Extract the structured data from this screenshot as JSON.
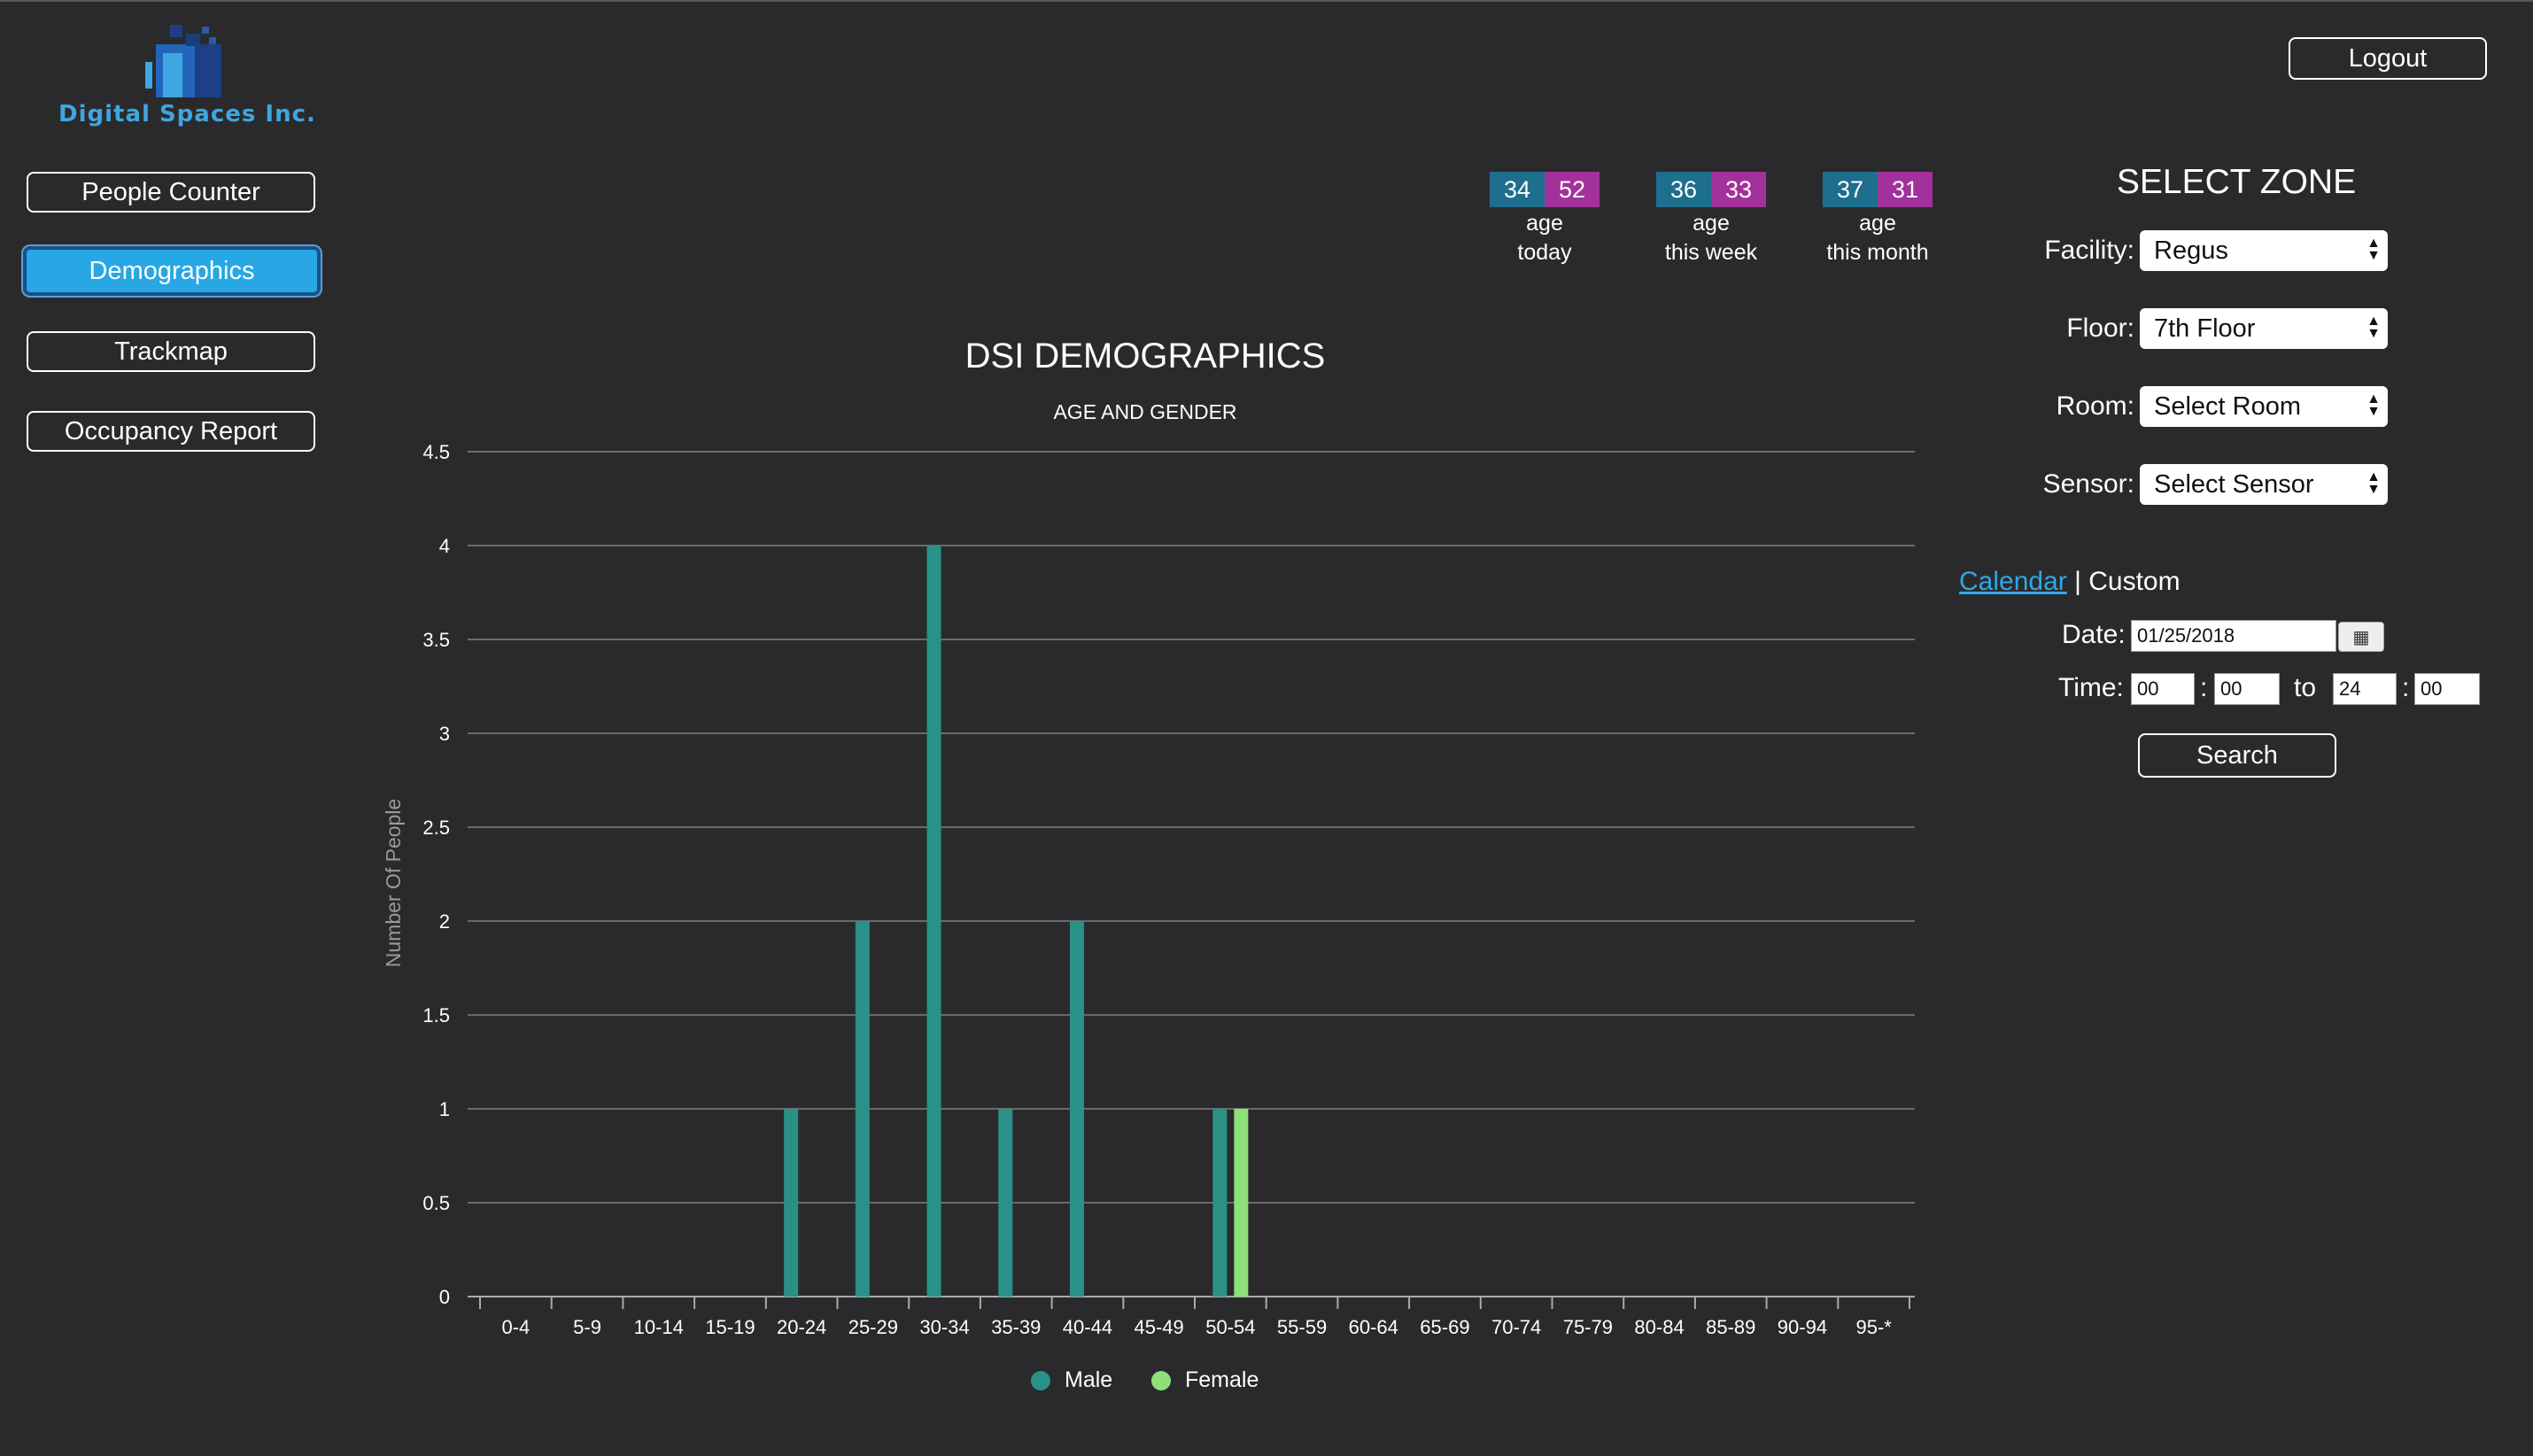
{
  "logo": {
    "text": "Digital Spaces Inc."
  },
  "nav": {
    "items": [
      {
        "label": "People Counter"
      },
      {
        "label": "Demographics"
      },
      {
        "label": "Trackmap"
      },
      {
        "label": "Occupancy Report"
      }
    ],
    "active": "Demographics"
  },
  "header": {
    "logout_label": "Logout"
  },
  "stats": [
    {
      "male": "34",
      "female": "52",
      "line1": "age",
      "line2": "today"
    },
    {
      "male": "36",
      "female": "33",
      "line1": "age",
      "line2": "this week"
    },
    {
      "male": "37",
      "female": "31",
      "line1": "age",
      "line2": "this month"
    }
  ],
  "zone": {
    "title": "SELECT ZONE",
    "facility_label": "Facility:",
    "facility_value": "Regus",
    "floor_label": "Floor:",
    "floor_value": "7th Floor",
    "room_label": "Room:",
    "room_value": "Select Room",
    "sensor_label": "Sensor:",
    "sensor_value": "Select Sensor",
    "calendar_link": "Calendar",
    "separator": "|",
    "custom_label": "Custom",
    "date_label": "Date:",
    "date_value": "01/25/2018",
    "time_label": "Time:",
    "time_from_h": "00",
    "time_from_m": "00",
    "time_to_label": "to",
    "time_to_h": "24",
    "time_to_m": "00",
    "colon": ":",
    "search_label": "Search"
  },
  "colors": {
    "male": "#2a9187",
    "female": "#8de07a",
    "accent": "#27a7e4",
    "background": "#2a2a2c"
  },
  "chart_data": {
    "type": "bar",
    "title": "DSI DEMOGRAPHICS",
    "subtitle": "AGE AND GENDER",
    "xlabel": "",
    "ylabel": "Number Of People",
    "ylim": [
      0,
      4.5
    ],
    "yticks": [
      "0",
      "0.5",
      "1",
      "1.5",
      "2",
      "2.5",
      "3",
      "3.5",
      "4",
      "4.5"
    ],
    "categories": [
      "0-4",
      "5-9",
      "10-14",
      "15-19",
      "20-24",
      "25-29",
      "30-34",
      "35-39",
      "40-44",
      "45-49",
      "50-54",
      "55-59",
      "60-64",
      "65-69",
      "70-74",
      "75-79",
      "80-84",
      "85-89",
      "90-94",
      "95-*"
    ],
    "series": [
      {
        "name": "Male",
        "color": "#2a9187",
        "values": [
          0,
          0,
          0,
          0,
          1,
          2,
          4,
          1,
          2,
          0,
          1,
          0,
          0,
          0,
          0,
          0,
          0,
          0,
          0,
          0
        ]
      },
      {
        "name": "Female",
        "color": "#8de07a",
        "values": [
          0,
          0,
          0,
          0,
          0,
          0,
          0,
          0,
          0,
          0,
          1,
          0,
          0,
          0,
          0,
          0,
          0,
          0,
          0,
          0
        ]
      }
    ],
    "grid": true,
    "legend_position": "bottom"
  }
}
